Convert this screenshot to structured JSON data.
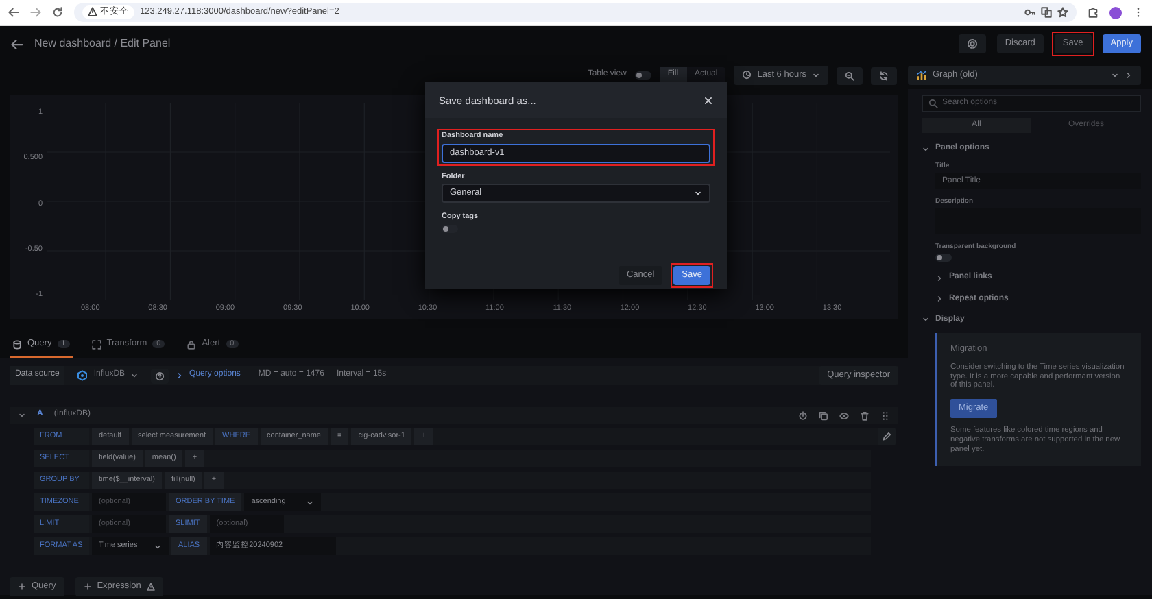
{
  "browser": {
    "security": "不安全",
    "url": "123.249.27.118:3000/dashboard/new?editPanel=2"
  },
  "header": {
    "title": "New dashboard / Edit Panel",
    "buttons": [
      {
        "label": "Discard",
        "kind": "secondary",
        "highlighted": false
      },
      {
        "label": "Save",
        "kind": "secondary",
        "highlighted": true
      },
      {
        "label": "Apply",
        "kind": "primary",
        "highlighted": false
      }
    ]
  },
  "toolbar": {
    "table_view": {
      "label": "Table view",
      "on": false
    },
    "fit_modes": [
      {
        "label": "Fill",
        "selected": true
      },
      {
        "label": "Actual",
        "selected": false
      }
    ],
    "time_range": "Last 6 hours"
  },
  "graph": {
    "y_labels": [
      "1",
      "0.500",
      "0",
      "-0.50",
      "-1"
    ],
    "x_labels": [
      "08:00",
      "08:30",
      "09:00",
      "09:30",
      "10:00",
      "10:30",
      "11:00",
      "11:30",
      "12:00",
      "12:30",
      "13:00",
      "13:30"
    ]
  },
  "modal": {
    "title": "Save dashboard as...",
    "fields": [
      {
        "label": "Dashboard name",
        "kind": "input",
        "value": "dashboard-v1",
        "highlighted": true
      },
      {
        "label": "Folder",
        "kind": "select",
        "value": "General"
      },
      {
        "label": "Copy tags",
        "kind": "switch",
        "on": false
      }
    ],
    "buttons": [
      {
        "label": "Cancel",
        "kind": "secondary",
        "highlighted": false
      },
      {
        "label": "Save",
        "kind": "primary",
        "highlighted": true
      }
    ]
  },
  "query_tabs": [
    {
      "label": "Query",
      "count": "1",
      "selected": true
    },
    {
      "label": "Transform",
      "count": "0",
      "selected": false
    },
    {
      "label": "Alert",
      "count": "0",
      "selected": false
    }
  ],
  "data_source": {
    "label": "Data source",
    "name": "InfluxDB",
    "options_link": "Query options",
    "info": "MD = auto = 1476",
    "interval": "Interval = 15s",
    "inspector": "Query inspector"
  },
  "query": {
    "ref": "A",
    "source": "(InfluxDB)",
    "rows": [
      {
        "keyword": "FROM",
        "parts": [
          {
            "kind": "segment",
            "text": "default"
          },
          {
            "kind": "segment",
            "text": "select measurement"
          },
          {
            "kind": "keyword",
            "text": "WHERE"
          },
          {
            "kind": "segment",
            "text": "container_name"
          },
          {
            "kind": "segment",
            "text": "="
          },
          {
            "kind": "segment",
            "text": "cig-cadvisor-1"
          },
          {
            "kind": "segment",
            "text": "+"
          }
        ]
      },
      {
        "keyword": "SELECT",
        "parts": [
          {
            "kind": "segment",
            "text": "field(value)"
          },
          {
            "kind": "segment",
            "text": "mean()"
          },
          {
            "kind": "segment",
            "text": "+"
          }
        ]
      },
      {
        "keyword": "GROUP BY",
        "parts": [
          {
            "kind": "segment",
            "text": "time($__interval)"
          },
          {
            "kind": "segment",
            "text": "fill(null)"
          },
          {
            "kind": "segment",
            "text": "+"
          }
        ]
      },
      {
        "keyword": "TIMEZONE",
        "parts": [
          {
            "kind": "input",
            "placeholder": "(optional)"
          },
          {
            "kind": "keyword",
            "text": "ORDER BY TIME"
          },
          {
            "kind": "select",
            "text": "ascending"
          }
        ]
      },
      {
        "keyword": "LIMIT",
        "parts": [
          {
            "kind": "input",
            "placeholder": "(optional)"
          },
          {
            "kind": "keyword",
            "text": "SLIMIT"
          },
          {
            "kind": "input",
            "placeholder": "(optional)"
          }
        ]
      },
      {
        "keyword": "FORMAT AS",
        "parts": [
          {
            "kind": "select",
            "text": "Time series"
          },
          {
            "kind": "keyword",
            "text": "ALIAS"
          },
          {
            "kind": "input",
            "value": "内容监控20240902"
          }
        ]
      }
    ]
  },
  "add_buttons": [
    {
      "label": "Query",
      "warning": false
    },
    {
      "label": "Expression",
      "warning": true
    }
  ],
  "options": {
    "visualization": "Graph (old)",
    "search_placeholder": "Search options",
    "tabs": [
      {
        "label": "All",
        "selected": true
      },
      {
        "label": "Overrides",
        "selected": false
      }
    ],
    "panel_options": {
      "label": "Panel options",
      "expanded": true,
      "title_label": "Title",
      "title_value": "Panel Title",
      "description_label": "Description",
      "transparent_label": "Transparent background",
      "transparent_on": false
    },
    "subsections": [
      {
        "label": "Panel links",
        "expanded": false
      },
      {
        "label": "Repeat options",
        "expanded": false
      }
    ],
    "display": {
      "label": "Display",
      "expanded": true
    },
    "migration": {
      "title": "Migration",
      "text": "Consider switching to the Time series visualization type. It is a more capable and performant version of this panel.",
      "button": "Migrate",
      "note": "Some features like colored time regions and negative transforms are not supported in the new panel yet."
    }
  }
}
